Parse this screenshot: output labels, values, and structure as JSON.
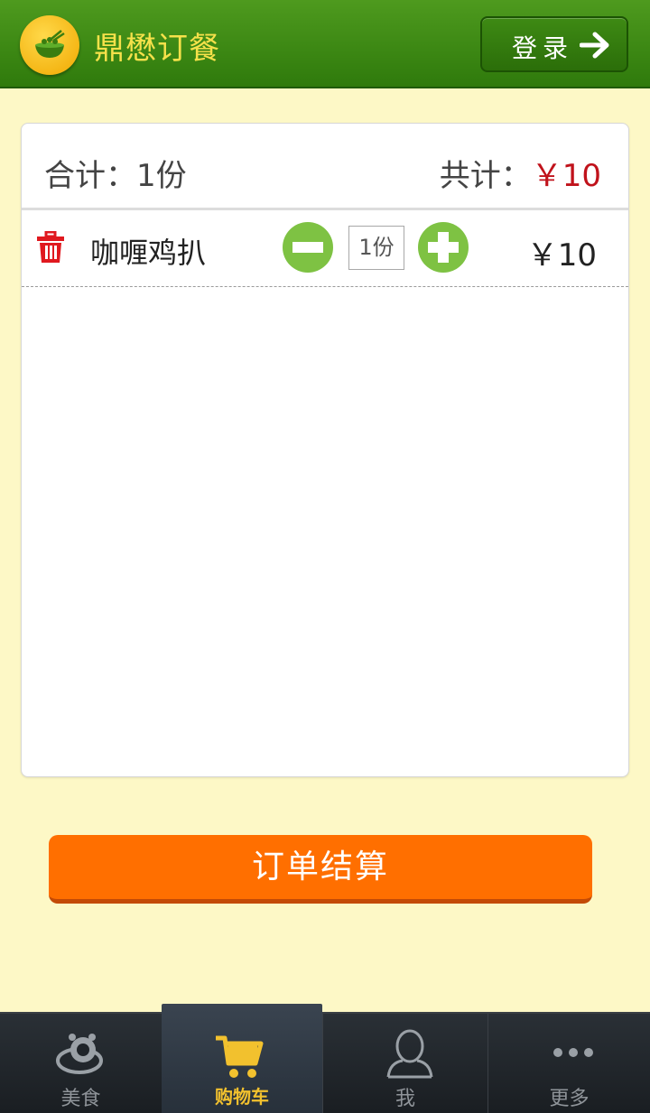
{
  "header": {
    "app_title": "鼎懋订餐",
    "login_label": "登录",
    "logo_icon": "rice-bowl-icon",
    "login_icon": "arrow-right-icon"
  },
  "cart": {
    "count_label": "合计：1份",
    "total_label": "共计：",
    "total_price": "￥10",
    "items": [
      {
        "name": "咖喱鸡扒",
        "quantity": "1份",
        "price": "￥10"
      }
    ]
  },
  "checkout": {
    "label": "订单结算"
  },
  "tabbar": {
    "tabs": [
      {
        "label": "美食",
        "icon": "food-icon",
        "active": false
      },
      {
        "label": "购物车",
        "icon": "cart-icon",
        "active": true
      },
      {
        "label": "我",
        "icon": "person-icon",
        "active": false
      },
      {
        "label": "更多",
        "icon": "more-dots-icon",
        "active": false
      }
    ]
  },
  "colors": {
    "header_green": "#3b8a15",
    "title_yellow": "#f6e14a",
    "page_bg": "#FDF8C6",
    "price_red": "#c0121b",
    "stepper_green": "#7ec243",
    "checkout_orange": "#ff6f00",
    "tab_active": "#f2c12e"
  }
}
